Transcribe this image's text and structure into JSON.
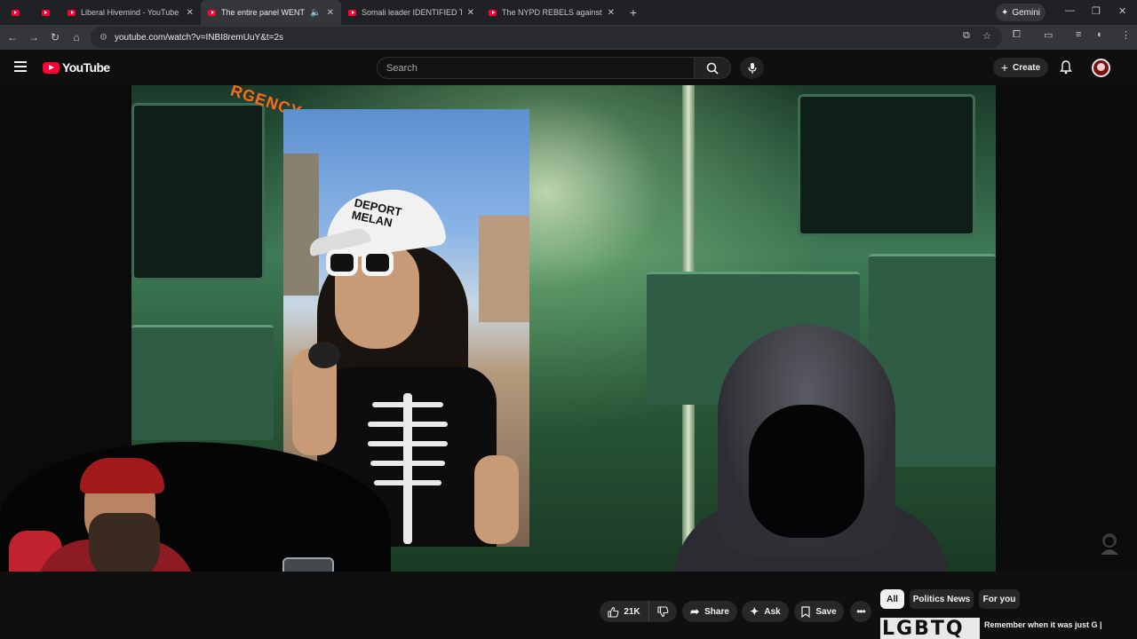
{
  "browser": {
    "tabs": [
      {
        "label": "",
        "active": false
      },
      {
        "label": "",
        "active": false
      },
      {
        "label": "Liberal Hivemind - YouTube",
        "active": false
      },
      {
        "label": "The entire panel WENT SILE",
        "active": true,
        "audio": true
      },
      {
        "label": "Somali leader IDENTIFIED Tim W",
        "active": false
      },
      {
        "label": "The NYPD REBELS against Mam",
        "active": false
      }
    ],
    "gemini_label": "Gemini",
    "url": "youtube.com/watch?v=INBI8remUuY&t=2s"
  },
  "youtube": {
    "logo_text": "YouTube",
    "search_placeholder": "Search",
    "create_label": "Create"
  },
  "video": {
    "cap_text_line1": "DEPORT",
    "cap_text_line2": "MELAN",
    "sign_text": "RGENCY"
  },
  "actions": {
    "likes": "21K",
    "share_label": "Share",
    "ask_label": "Ask",
    "save_label": "Save"
  },
  "sidebar": {
    "chips": [
      "All",
      "Politics News",
      "For you"
    ],
    "rec_thumb_text": "LGBTQ",
    "rec_title": "Remember when it was just G |"
  },
  "colors": {
    "accent": "#ff0033",
    "background": "#0f0f0f",
    "pill": "#272727"
  }
}
